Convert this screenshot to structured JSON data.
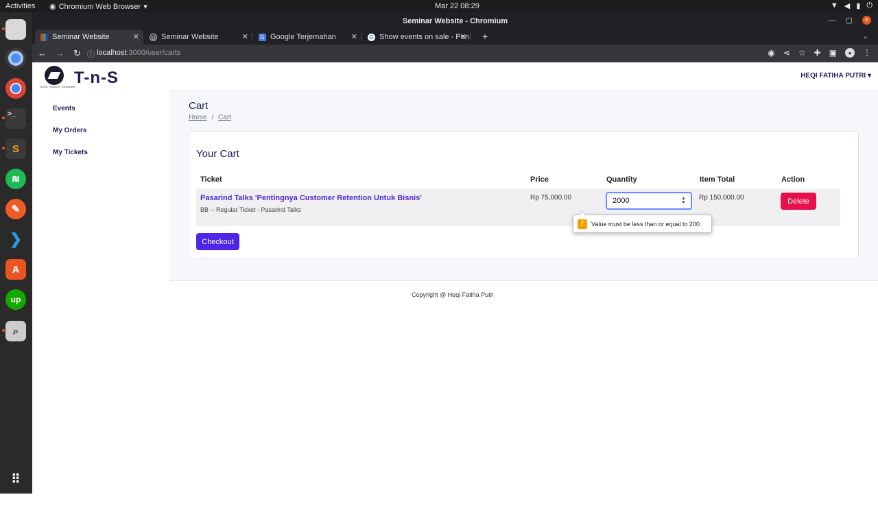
{
  "topbar": {
    "activities": "Activities",
    "app_name": "Chromium Web Browser",
    "clock": "Mar 22  08:29"
  },
  "dock": {
    "items": [
      "files-icon",
      "chromium-icon",
      "chrome-icon",
      "terminal-icon",
      "sublime-icon",
      "spotify-icon",
      "postman-icon",
      "vscode-icon",
      "app-store-icon",
      "upwork-icon",
      "search-app-icon",
      "app-grid-icon"
    ]
  },
  "window": {
    "title": "Seminar Website - Chromium"
  },
  "tabs": [
    {
      "label": "Seminar Website"
    },
    {
      "label": "Seminar Website"
    },
    {
      "label": "Google Terjemahan"
    },
    {
      "label": "Show events on sale - Pen"
    }
  ],
  "address": {
    "host": "localhost",
    "path": ":3000/user/carts"
  },
  "site": {
    "brand": "T-n-S",
    "logo_tagline": "TICKETSNACK SEMINAR",
    "user": "HEQI FATIHA PUTRI"
  },
  "sidebar": {
    "items": [
      {
        "label": "Events"
      },
      {
        "label": "My Orders"
      },
      {
        "label": "My Tickets"
      }
    ]
  },
  "page": {
    "title": "Cart",
    "breadcrumb": [
      "Home",
      "Cart"
    ],
    "breadcrumb_sep": "/"
  },
  "cart": {
    "heading": "Your Cart",
    "columns": [
      "Ticket",
      "Price",
      "Quantity",
      "Item Total",
      "Action"
    ],
    "rows": [
      {
        "ticket": "Pasarind Talks 'Pentingnya Customer Retention Untuk Bisnis'",
        "detail": "BB -- Regular Ticket - Pasarind Talks",
        "price": "Rp 75,000.00",
        "quantity": "2000",
        "total": "Rp 150,000.00",
        "action": "Delete"
      }
    ],
    "validation": "Value must be less than or equal to 200.",
    "checkout": "Checkout"
  },
  "footer": {
    "copyright": "Copyright @ Heqi Fatiha Putri"
  }
}
